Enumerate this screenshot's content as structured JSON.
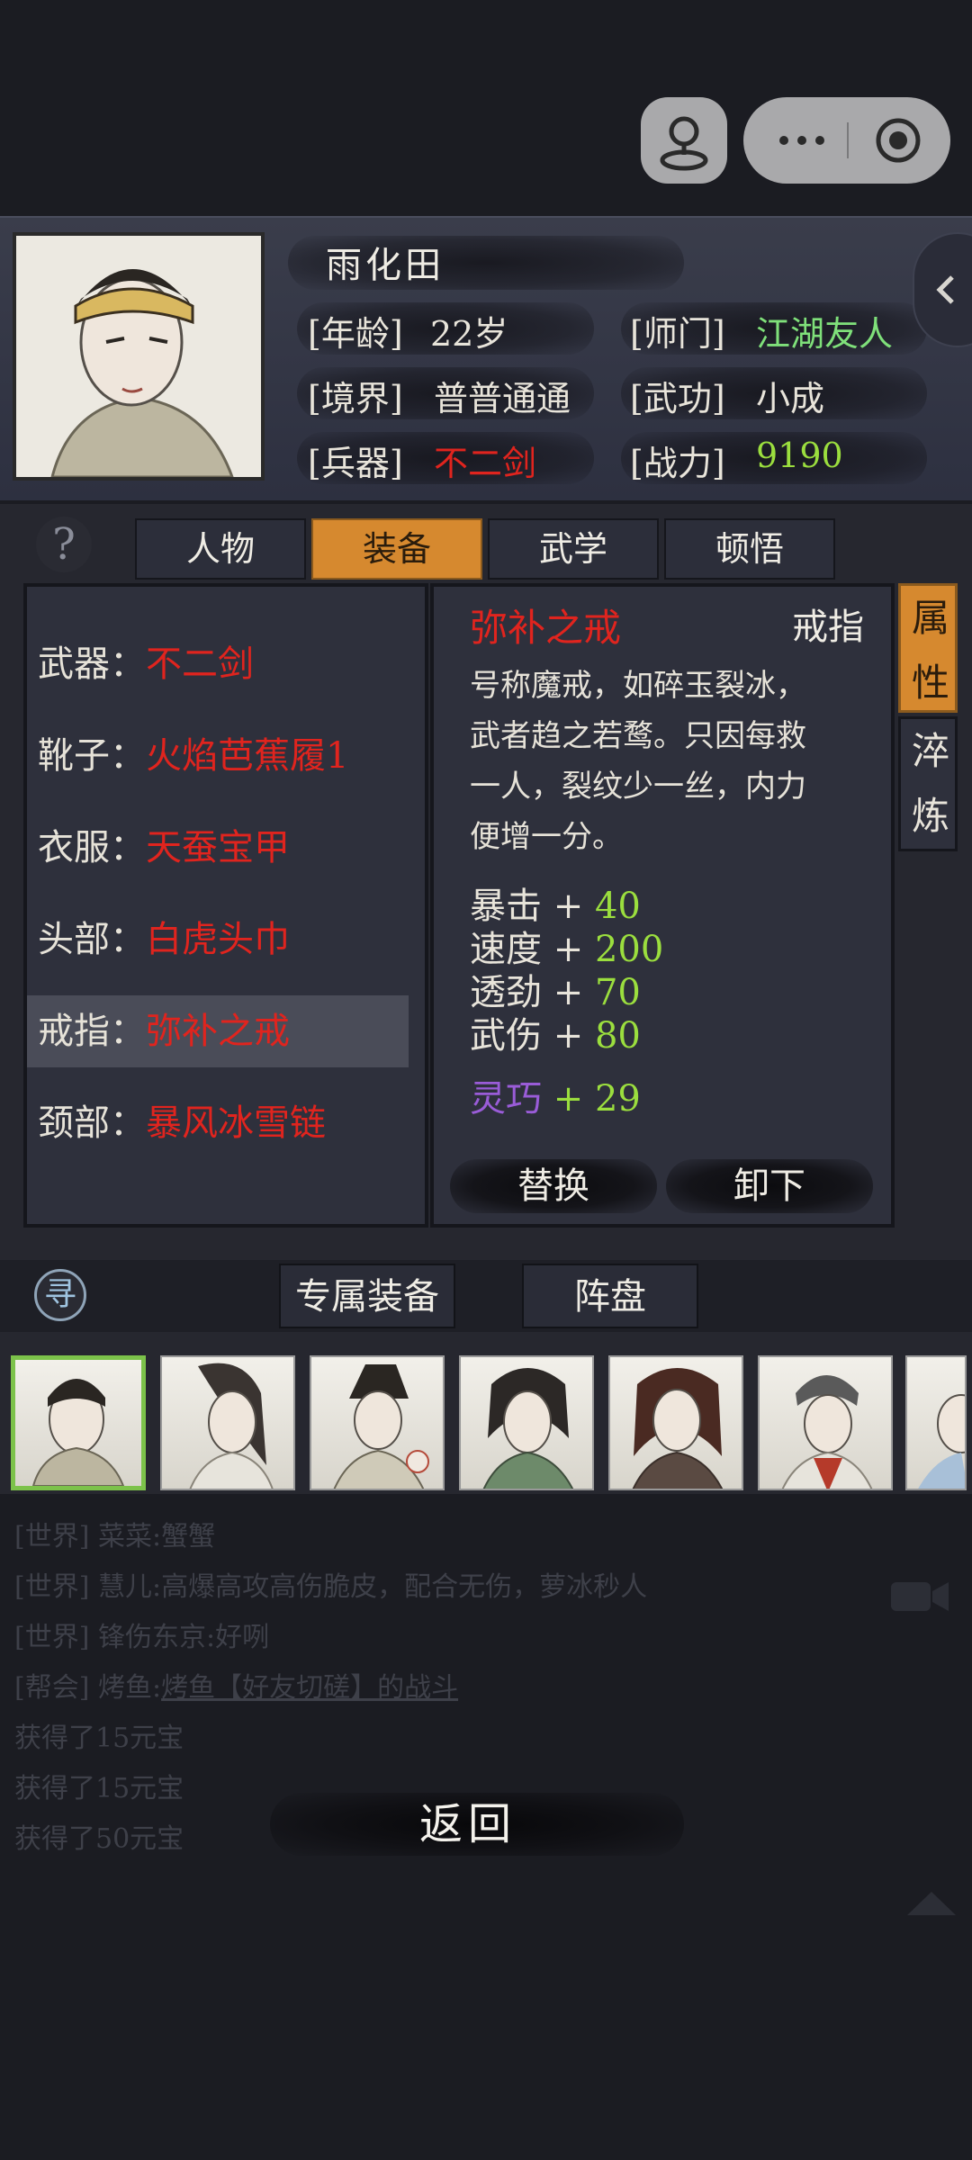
{
  "topbar": {
    "capsule_more_icon": "more-dots-icon",
    "capsule_close_icon": "target-circle-icon",
    "game_icon": "joystick-icon"
  },
  "profile": {
    "name": "雨化田",
    "age_label": "[年龄]",
    "age_value": "22岁",
    "sect_label": "[师门]",
    "sect_value": "江湖友人",
    "realm_label": "[境界]",
    "realm_value": "普普通通",
    "martial_label": "[武功]",
    "martial_value": "小成",
    "weapon_label": "[兵器]",
    "weapon_value": "不二剑",
    "power_label": "[战力]",
    "power_value": "9190"
  },
  "tabs": {
    "help": "?",
    "items": [
      "人物",
      "装备",
      "武学",
      "顿悟"
    ],
    "active": "装备"
  },
  "equipment": [
    {
      "slot": "武器：",
      "name": "不二剑"
    },
    {
      "slot": "靴子：",
      "name": "火焰芭蕉履1"
    },
    {
      "slot": "衣服：",
      "name": "天蚕宝甲"
    },
    {
      "slot": "头部：",
      "name": "白虎头巾"
    },
    {
      "slot": "戒指：",
      "name": "弥补之戒"
    },
    {
      "slot": "颈部：",
      "name": "暴风冰雪链"
    }
  ],
  "detail": {
    "item_name": "弥补之戒",
    "item_type": "戒指",
    "desc_lines": [
      "号称魔戒，如碎玉裂冰，",
      "武者趋之若鹜。只因每救",
      "一人，裂纹少一丝，内力",
      "便增一分。"
    ],
    "stats": [
      {
        "label": "暴击 + ",
        "value": "40"
      },
      {
        "label": "速度 + ",
        "value": "200"
      },
      {
        "label": "透劲 + ",
        "value": "70"
      },
      {
        "label": "武伤 + ",
        "value": "80"
      }
    ],
    "special_label": "灵巧",
    "special_plus": " + ",
    "special_value": "29",
    "replace_button": "替换",
    "unequip_button": "卸下"
  },
  "side_tabs": {
    "attr_1": "属",
    "attr_2": "性",
    "refine_1": "淬",
    "refine_2": "炼"
  },
  "bottom_tabs": {
    "seek": "寻",
    "exclusive": "专属装备",
    "formation": "阵盘"
  },
  "chat": [
    {
      "channel": "[世界]",
      "user": "菜菜:",
      "text": "蟹蟹"
    },
    {
      "channel": "[世界]",
      "user": "慧儿:",
      "text": "高爆高攻高伤脆皮，配合无伤，萝冰秒人"
    },
    {
      "channel": "[世界]",
      "user": "锋伤东京:",
      "text": "好咧"
    },
    {
      "channel": "[帮会]",
      "user": "烤鱼:",
      "text": "烤鱼【好友切磋】的战斗"
    },
    {
      "channel": "",
      "user": "",
      "text": "获得了15元宝"
    },
    {
      "channel": "",
      "user": "",
      "text": "获得了15元宝"
    },
    {
      "channel": "",
      "user": "",
      "text": "获得了50元宝"
    }
  ],
  "back_button": "返回",
  "colors": {
    "accent_orange": "#d6892f",
    "equip_red": "#e0241e",
    "stat_green": "#9bde3e",
    "special_purple": "#9a5cd8",
    "sect_green": "#7fe07a"
  }
}
